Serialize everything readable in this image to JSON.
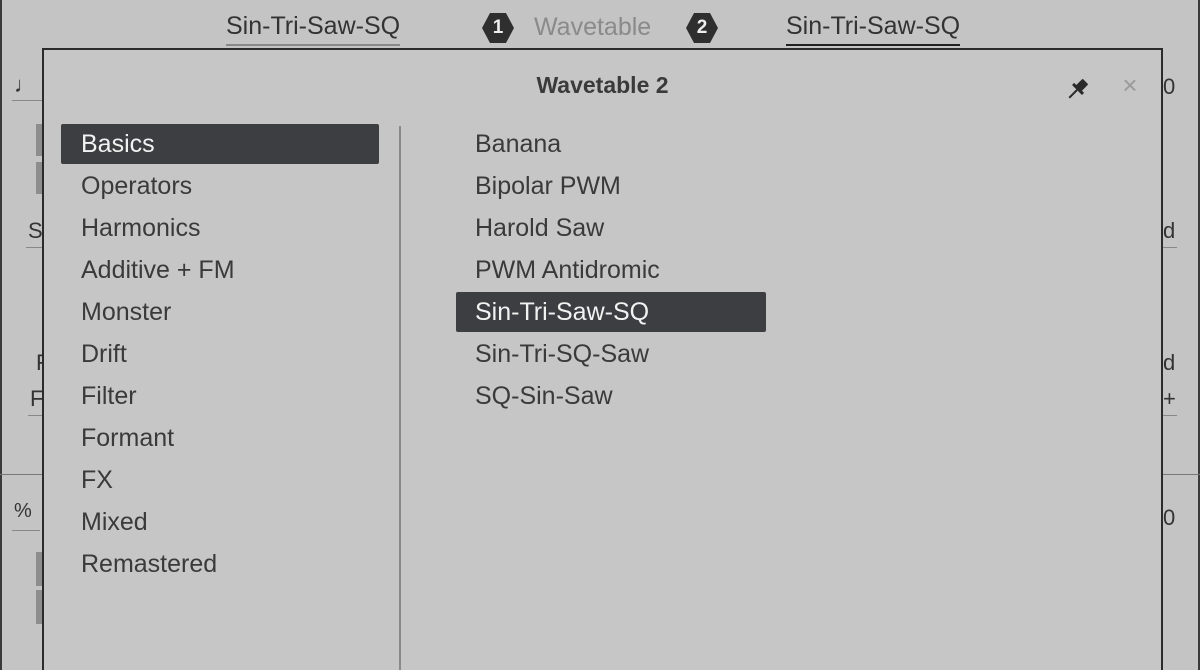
{
  "header": {
    "osc1_wavetable": "Sin-Tri-Saw-SQ",
    "badge_1": "1",
    "section_label": "Wavetable",
    "badge_2": "2",
    "osc2_wavetable": "Sin-Tri-Saw-SQ"
  },
  "background_edges": {
    "left": [
      "♩",
      "S",
      "F",
      "F",
      "%"
    ],
    "right": [
      "0",
      "d",
      "d",
      "+",
      "0"
    ]
  },
  "popup": {
    "title": "Wavetable 2",
    "pin_icon": "pin-icon",
    "close_icon": "×",
    "categories": [
      {
        "label": "Basics",
        "selected": true
      },
      {
        "label": "Operators",
        "selected": false
      },
      {
        "label": "Harmonics",
        "selected": false
      },
      {
        "label": "Additive + FM",
        "selected": false
      },
      {
        "label": "Monster",
        "selected": false
      },
      {
        "label": "Drift",
        "selected": false
      },
      {
        "label": "Filter",
        "selected": false
      },
      {
        "label": "Formant",
        "selected": false
      },
      {
        "label": "FX",
        "selected": false
      },
      {
        "label": "Mixed",
        "selected": false
      },
      {
        "label": "Remastered",
        "selected": false
      }
    ],
    "presets": [
      {
        "label": "Banana",
        "selected": false
      },
      {
        "label": "Bipolar PWM",
        "selected": false
      },
      {
        "label": "Harold Saw",
        "selected": false
      },
      {
        "label": "PWM Antidromic",
        "selected": false
      },
      {
        "label": "Sin-Tri-Saw-SQ",
        "selected": true
      },
      {
        "label": "Sin-Tri-SQ-Saw",
        "selected": false
      },
      {
        "label": "SQ-Sin-Saw",
        "selected": false
      }
    ]
  },
  "colors": {
    "background": "#c4c4c4",
    "selection": "#3d3e41",
    "text": "#3a3a3a",
    "muted_text": "#8a8a8a"
  }
}
